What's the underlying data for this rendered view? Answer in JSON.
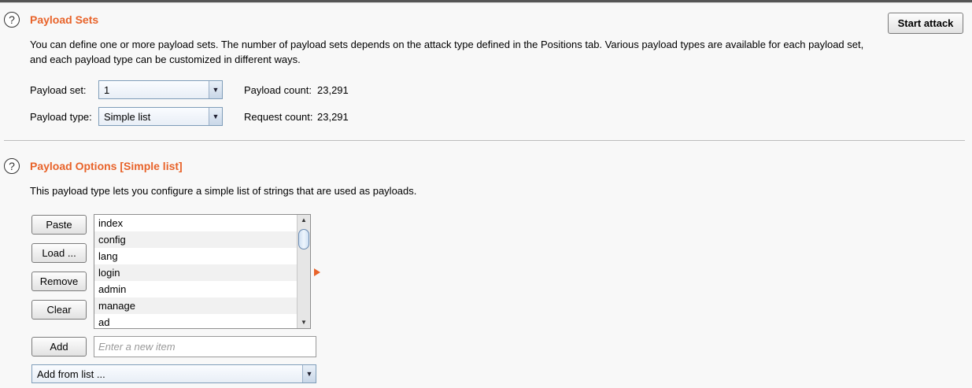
{
  "payload_sets": {
    "title": "Payload Sets",
    "start_attack_label": "Start attack",
    "description_line1": "You can define one or more payload sets. The number of payload sets depends on the attack type defined in the Positions tab. Various payload types are available for each payload set,",
    "description_line2": "and each payload type can be customized in different ways.",
    "payload_set_label": "Payload set:",
    "payload_set_value": "1",
    "payload_type_label": "Payload type:",
    "payload_type_value": "Simple list",
    "payload_count_label": "Payload count:",
    "payload_count_value": "23,291",
    "request_count_label": "Request count:",
    "request_count_value": "23,291"
  },
  "payload_options": {
    "title": "Payload Options [Simple list]",
    "description": "This payload type lets you configure a simple list of strings that are used as payloads.",
    "buttons": {
      "paste": "Paste",
      "load": "Load ...",
      "remove": "Remove",
      "clear": "Clear",
      "add": "Add"
    },
    "items": [
      "index",
      "config",
      "lang",
      "login",
      "admin",
      "manage",
      "ad"
    ],
    "new_item_placeholder": "Enter a new item",
    "add_from_list_label": "Add from list ..."
  },
  "icons": {
    "help": "help-circle-icon",
    "dropdown": "chevron-down-icon"
  },
  "colors": {
    "accent": "#e8632a"
  }
}
